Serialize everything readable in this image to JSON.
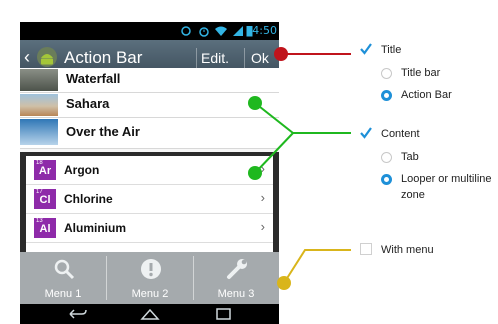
{
  "status_bar": {
    "time": "4:50"
  },
  "action_bar": {
    "title": "Action Bar",
    "edit_label": "Edit.",
    "ok_label": "Ok"
  },
  "list_items": [
    "Waterfall",
    "Sahara",
    "Over the Air"
  ],
  "elements": [
    {
      "number": "18",
      "symbol": "Ar",
      "name": "Argon"
    },
    {
      "number": "17",
      "symbol": "Cl",
      "name": "Chlorine"
    },
    {
      "number": "13",
      "symbol": "Al",
      "name": "Aluminium"
    }
  ],
  "menu": [
    {
      "label": "Menu 1",
      "icon": "search-icon"
    },
    {
      "label": "Menu 2",
      "icon": "alert-icon"
    },
    {
      "label": "Menu 3",
      "icon": "wrench-icon"
    }
  ],
  "options": {
    "title": {
      "label": "Title",
      "checked": true,
      "choices": [
        {
          "label": "Title bar",
          "selected": false
        },
        {
          "label": "Action Bar",
          "selected": true
        }
      ]
    },
    "content": {
      "label": "Content",
      "checked": true,
      "choices": [
        {
          "label": "Tab",
          "selected": false
        },
        {
          "label": "Looper or multiline",
          "label_line2": "zone",
          "selected": true
        }
      ]
    },
    "with_menu": {
      "label": "With menu",
      "checked": false
    }
  },
  "colors": {
    "accent": "#1e90d8",
    "element_badge": "#8e2aa9",
    "callout_red": "#c0141c",
    "callout_green": "#1fb81f",
    "callout_yellow": "#d9b51b"
  }
}
